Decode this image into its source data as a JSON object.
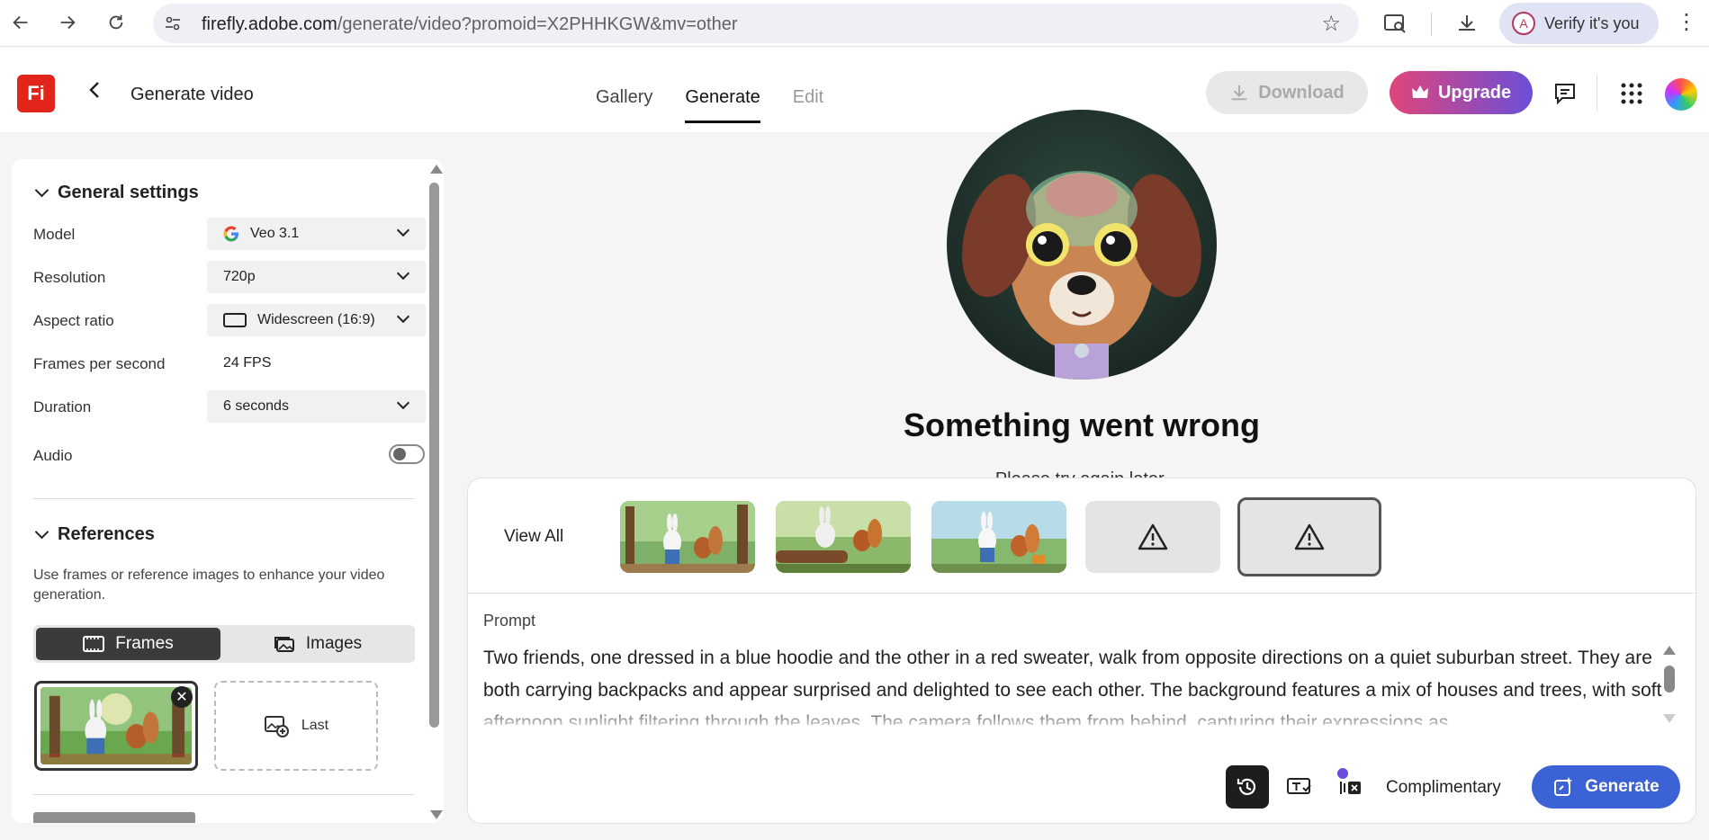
{
  "browser": {
    "url_host": "firefly.adobe.com",
    "url_path": "/generate/video?promoid=X2PHHKGW&mv=other",
    "profile_initial": "A",
    "verify_label": "Verify it's you"
  },
  "header": {
    "logo_text": "Fi",
    "page_title": "Generate video",
    "tabs": [
      {
        "label": "Gallery"
      },
      {
        "label": "Generate"
      },
      {
        "label": "Edit"
      }
    ],
    "download_label": "Download",
    "upgrade_label": "Upgrade"
  },
  "settings": {
    "section_title": "General settings",
    "model_label": "Model",
    "model_value": "Veo 3.1",
    "resolution_label": "Resolution",
    "resolution_value": "720p",
    "aspect_label": "Aspect ratio",
    "aspect_value": "Widescreen (16:9)",
    "fps_label": "Frames per second",
    "fps_value": "24 FPS",
    "duration_label": "Duration",
    "duration_value": "6 seconds",
    "audio_label": "Audio",
    "audio_on": false
  },
  "references": {
    "section_title": "References",
    "description": "Use frames or reference images to enhance your video generation.",
    "frames_label": "Frames",
    "images_label": "Images",
    "last_label": "Last"
  },
  "main": {
    "error_title": "Something went wrong",
    "error_subtitle": "Please try again later."
  },
  "prompt_card": {
    "view_all_label": "View All",
    "prompt_label": "Prompt",
    "prompt_text": "Two friends, one dressed in a blue hoodie and the other in a red sweater, walk from opposite directions on a quiet suburban street. They are both carrying backpacks and appear surprised and delighted to see each other. The background features a mix of houses and trees, with soft afternoon sunlight filtering through the leaves. The camera follows them from behind, capturing their expressions as",
    "credits_label": "Complimentary",
    "generate_label": "Generate"
  },
  "colors": {
    "brand_red": "#e1251b",
    "generate_blue": "#3b63d6",
    "upgrade_gradient_start": "#e0457b",
    "upgrade_gradient_end": "#6b4fd8"
  }
}
